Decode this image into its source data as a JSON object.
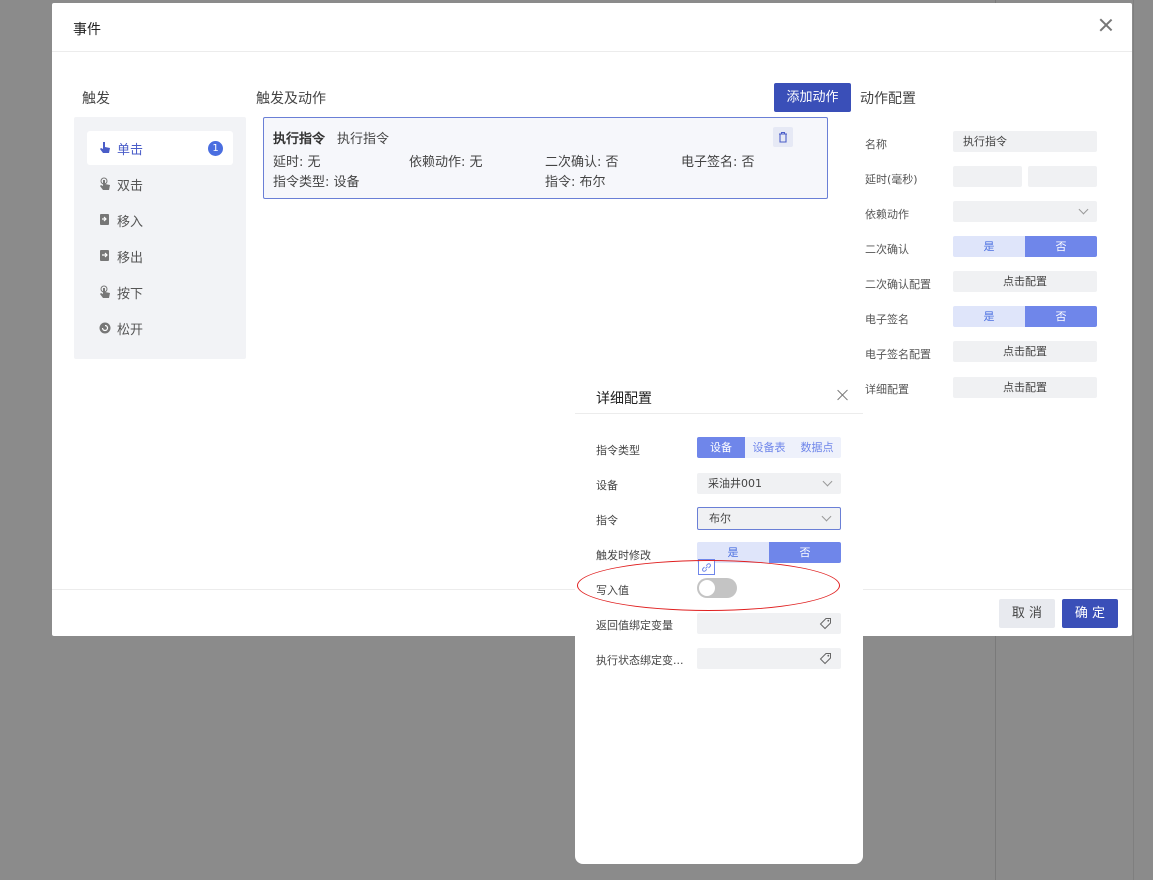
{
  "dialog": {
    "title": "事件",
    "trigger_title": "触发",
    "actions_title": "触发及动作",
    "add_action_label": "添加动作",
    "config_title": "动作配置",
    "cancel_label": "取 消",
    "ok_label": "确 定"
  },
  "triggers": [
    {
      "label": "单击",
      "icon": "pointer-hand-icon",
      "active": true,
      "badge": "1"
    },
    {
      "label": "双击",
      "icon": "double-tap-icon"
    },
    {
      "label": "移入",
      "icon": "move-in-icon"
    },
    {
      "label": "移出",
      "icon": "move-out-icon"
    },
    {
      "label": "按下",
      "icon": "press-icon"
    },
    {
      "label": "松开",
      "icon": "release-icon"
    }
  ],
  "action_card": {
    "type_label": "执行指令",
    "name": "执行指令",
    "delay": "延时: 无",
    "dependency": "依赖动作: 无",
    "second_confirm": "二次确认: 否",
    "e_signature": "电子签名: 否",
    "command_type": "指令类型: 设备",
    "command": "指令: 布尔"
  },
  "config": {
    "name_label": "名称",
    "name_value": "执行指令",
    "delay_label": "延时(毫秒)",
    "dependency_label": "依赖动作",
    "second_confirm_label": "二次确认",
    "yes": "是",
    "no": "否",
    "second_confirm_cfg_label": "二次确认配置",
    "click_config": "点击配置",
    "e_sign_label": "电子签名",
    "e_sign_cfg_label": "电子签名配置",
    "detail_cfg_label": "详细配置"
  },
  "popup": {
    "title": "详细配置",
    "command_type_label": "指令类型",
    "command_type_options": [
      "设备",
      "设备表",
      "数据点"
    ],
    "device_label": "设备",
    "device_value": "采油井001",
    "command_label": "指令",
    "command_value": "布尔",
    "modify_on_trigger_label": "触发时修改",
    "yes": "是",
    "no": "否",
    "write_value_label": "写入值",
    "write_value_on": false,
    "return_bind_label": "返回值绑定变量",
    "status_bind_label": "执行状态绑定变..."
  },
  "colors": {
    "accent": "#3a4fb8",
    "segment_on": "#6f86ea",
    "annotation": "#e02020"
  }
}
